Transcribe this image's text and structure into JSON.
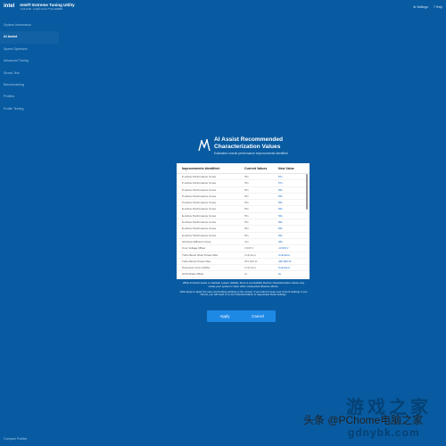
{
  "header": {
    "logo": "intel",
    "title": "Intel® Extreme Tuning Utility",
    "subtitle": "7.12.0.29 · Intel® Core™ i9-13900K",
    "actions": [
      "⚙ Settings",
      "? Help"
    ]
  },
  "sidebar": {
    "items": [
      {
        "label": "System Information",
        "active": false
      },
      {
        "label": "AI Assist",
        "active": true
      },
      {
        "label": "Speed Optimizer",
        "active": false
      },
      {
        "label": "Advanced Tuning",
        "active": false
      },
      {
        "label": "Stress Test",
        "active": false
      },
      {
        "label": "Benchmarking",
        "active": false
      },
      {
        "label": "Profiles",
        "active": false
      },
      {
        "label": "Profile Testing",
        "active": false
      }
    ],
    "bottom": "Compare Profiles"
  },
  "dialog": {
    "title_line1": "AI Assist Recommended",
    "title_line2": "Characterization Values",
    "subtitle": "Estimated overall performance improvements identified"
  },
  "table": {
    "headers": [
      "Improvements Identified:",
      "Current Values",
      "New Value"
    ],
    "rows": [
      [
        "P-Active Performance Cores",
        "55x",
        "57x"
      ],
      [
        "P-Active Performance Cores",
        "55x",
        "57x"
      ],
      [
        "P-Active Performance Cores",
        "55x",
        "56x"
      ],
      [
        "P-Active Performance Cores",
        "55x",
        "56x"
      ],
      [
        "P-Active Performance Cores",
        "55x",
        "56x"
      ],
      [
        "E-Active Performance Cores",
        "55x",
        "56x"
      ],
      [
        "E-Active Performance Cores",
        "55x",
        "56x"
      ],
      [
        "E-Active Performance Cores",
        "55x",
        "56x"
      ],
      [
        "E-Active Performance Cores",
        "55x",
        "56x"
      ],
      [
        "E-Active Performance Cores",
        "55x",
        "56x"
      ],
      [
        "All Active Efficient Cores",
        "44x",
        "45x"
      ],
      [
        "Core Voltage Offset",
        "0.000 V",
        "-0.030 V"
      ],
      [
        "Turbo Boost Short Power Max",
        "Unlimited",
        "Unlimited"
      ],
      [
        "Turbo Boost Power Max",
        "253.000 W",
        "420.000 W"
      ],
      [
        "Processor Core IccMax",
        "Unlimited",
        "Unlimited"
      ],
      [
        "AVX2 Ratio Offset",
        "0x",
        "0x"
      ]
    ]
  },
  "info": {
    "p1": "While AI Assist seeks to maintain system stability, there is a possibility that the characterization values may cause your system to have other unexpected adverse effects.",
    "p2": "Click Apply to apply the new overclocking settings to the current. If you want to keep your current settings, if you cancel, you will need to re-run characterization to regenerate these settings."
  },
  "buttons": {
    "apply": "Apply",
    "cancel": "Cancel"
  },
  "watermark": {
    "big": "游戏之家",
    "line": "头条 @PChome电脑之家",
    "url": "gdnybk.com"
  },
  "colors": {
    "background": "#0a62ad",
    "accent": "#1e88e5",
    "value_blue": "#1468c4"
  },
  "icons": {
    "ai": "ai-assist-icon",
    "settings": "gear-icon",
    "help": "help-icon"
  }
}
